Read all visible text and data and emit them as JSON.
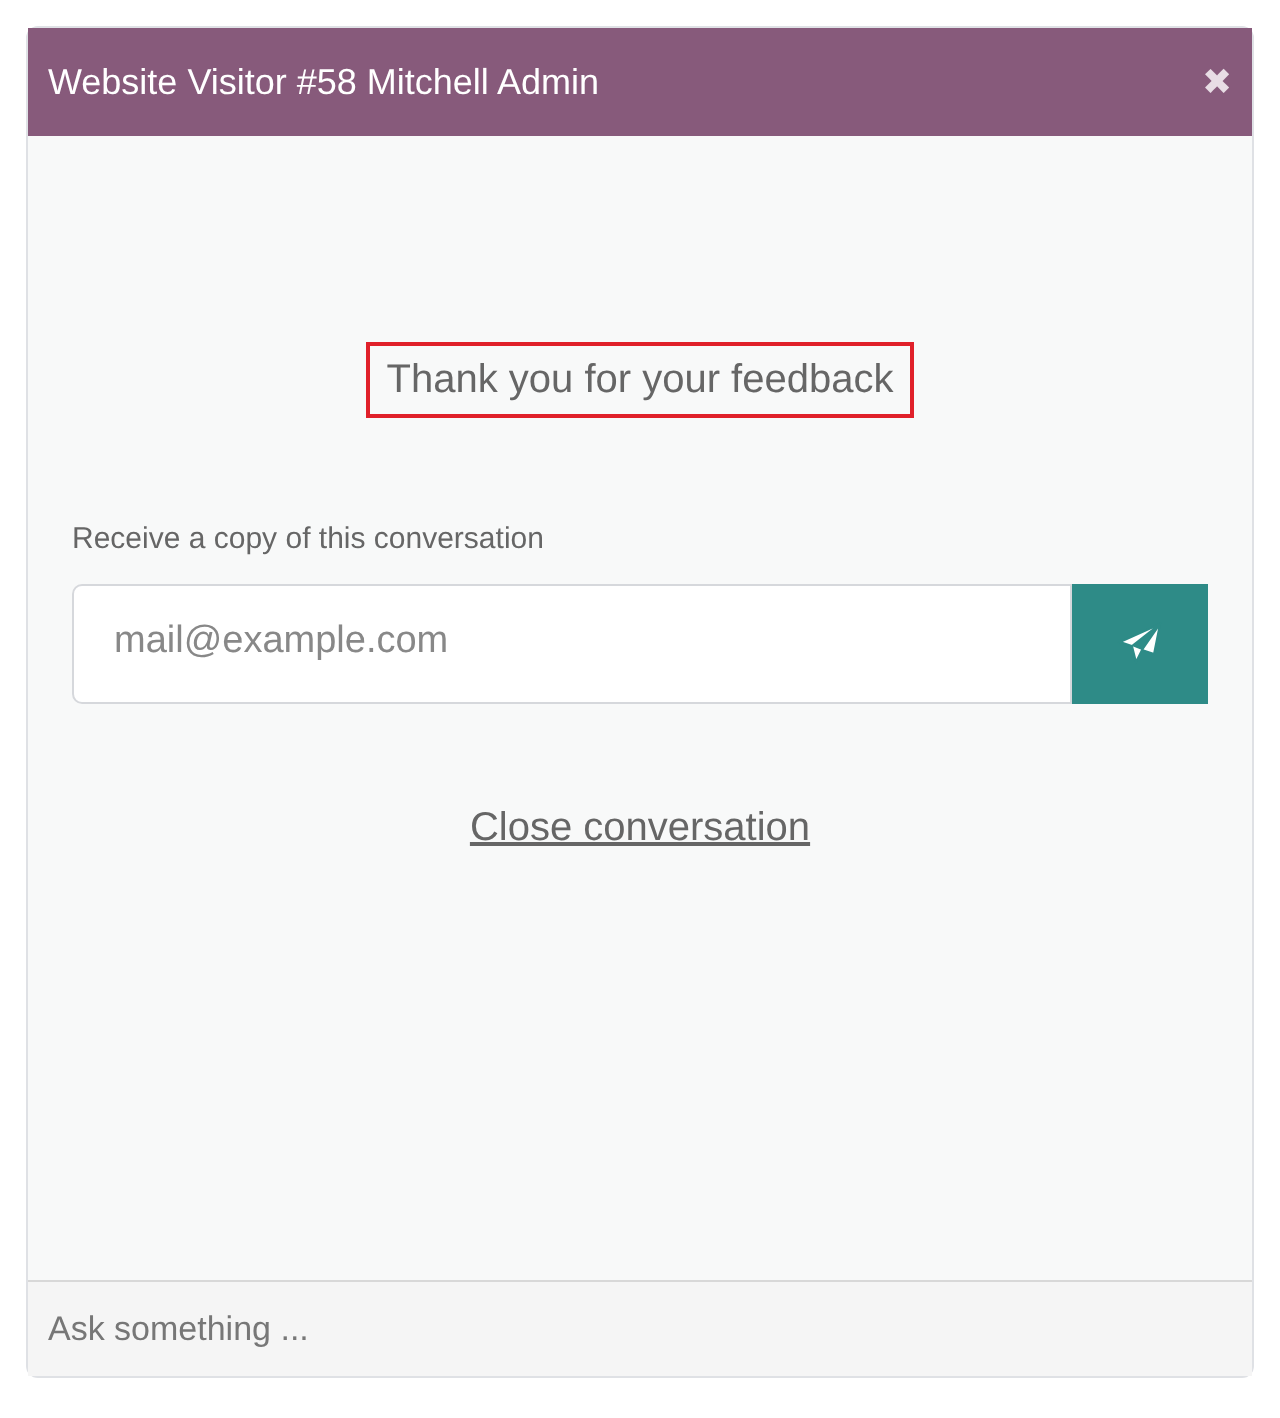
{
  "window": {
    "title": "Website Visitor #58 Mitchell Admin",
    "close_icon": "✖"
  },
  "feedback": {
    "message": "Thank you for your feedback",
    "highlighted": true
  },
  "transcript": {
    "label": "Receive a copy of this conversation",
    "email_field": {
      "placeholder": "mail@example.com"
    }
  },
  "close_link": "Close conversation",
  "composer": {
    "placeholder": "Ask something ..."
  }
}
